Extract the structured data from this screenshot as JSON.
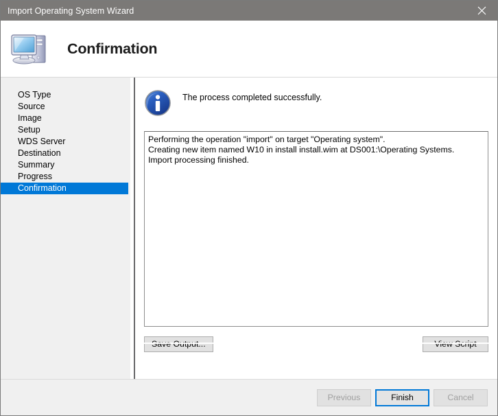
{
  "window": {
    "title": "Import Operating System Wizard",
    "close_icon": "close-icon",
    "titlebar_color": "#7b7977"
  },
  "header": {
    "title": "Confirmation",
    "icon": "computer-icon"
  },
  "sidebar": {
    "steps": [
      {
        "label": "OS Type",
        "current": false
      },
      {
        "label": "Source",
        "current": false
      },
      {
        "label": "Image",
        "current": false
      },
      {
        "label": "Setup",
        "current": false
      },
      {
        "label": "WDS Server",
        "current": false
      },
      {
        "label": "Destination",
        "current": false
      },
      {
        "label": "Summary",
        "current": false
      },
      {
        "label": "Progress",
        "current": false
      },
      {
        "label": "Confirmation",
        "current": true
      }
    ],
    "highlight_color": "#0078d7"
  },
  "content": {
    "status_icon": "info-icon",
    "status_message": "The process completed successfully.",
    "output_lines": [
      "Performing the operation \"import\" on target \"Operating system\".",
      "Creating new item named W10 in install install.wim at DS001:\\Operating Systems.",
      "Import processing finished."
    ],
    "save_output_label": "Save Output...",
    "view_script_label": "View Script"
  },
  "footer": {
    "previous_label": "Previous",
    "finish_label": "Finish",
    "cancel_label": "Cancel",
    "focus_color": "#0078d7"
  }
}
